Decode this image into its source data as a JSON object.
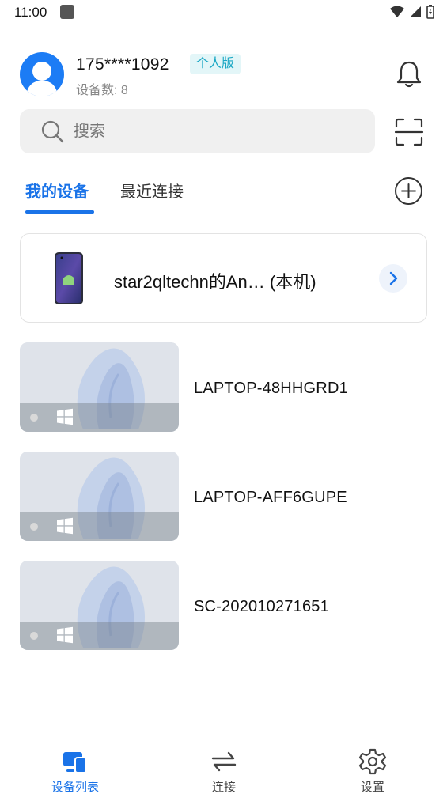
{
  "status_bar": {
    "time": "11:00"
  },
  "header": {
    "phone": "175****1092",
    "edition": "个人版",
    "device_count": "设备数: 8"
  },
  "search": {
    "placeholder": "搜索"
  },
  "tabs": {
    "mine": "我的设备",
    "recent": "最近连接",
    "active": "我的设备"
  },
  "local_device": {
    "name": "star2qltechn的An… (本机)"
  },
  "devices": [
    {
      "name": "LAPTOP-48HHGRD1",
      "os_icon": "windows-icon",
      "online": false
    },
    {
      "name": "LAPTOP-AFF6GUPE",
      "os_icon": "windows-icon",
      "online": false
    },
    {
      "name": "SC-202010271651",
      "os_icon": "windows-icon",
      "online": false
    }
  ],
  "bottom_nav": {
    "devices": "设备列表",
    "connect": "连接",
    "settings": "设置",
    "active": "设备列表"
  },
  "colors": {
    "accent": "#1a73e8",
    "avatar": "#1c7cf5",
    "badge_text": "#1aa7c4",
    "badge_bg": "#e3f6f8"
  }
}
